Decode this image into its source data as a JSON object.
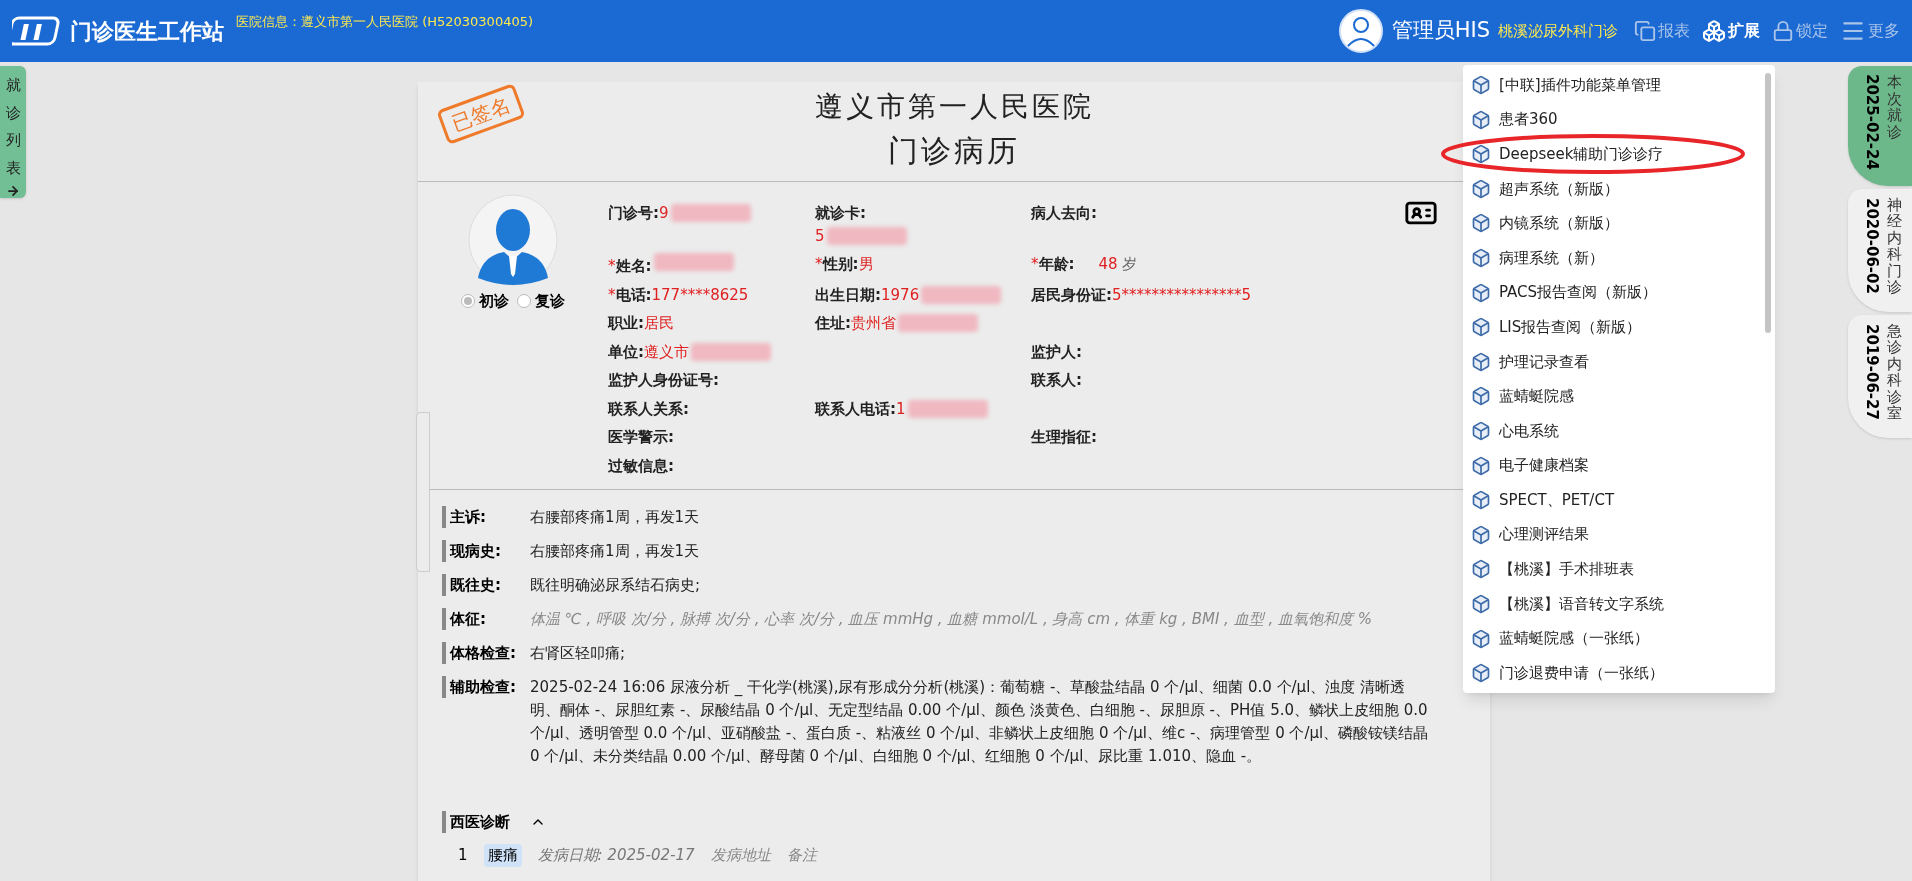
{
  "header": {
    "title": "门诊医生工作站",
    "hospital_info": "医院信息：遵义市第一人民医院 (H52030300405)",
    "user": "管理员HIS",
    "department": "桃溪泌尿外科门诊",
    "toolbar": [
      {
        "kind": "report",
        "label": "报表",
        "selected": false
      },
      {
        "kind": "extend",
        "label": "扩展",
        "selected": true
      },
      {
        "kind": "lock",
        "label": "锁定",
        "selected": false
      },
      {
        "kind": "more",
        "label": "更多",
        "selected": false
      }
    ]
  },
  "left_tab": {
    "chars": [
      "就",
      "诊",
      "列",
      "表"
    ]
  },
  "record": {
    "stamp": "已签名",
    "hospital": "遵义市第一人民医院",
    "title": "门诊病历",
    "visit_types": [
      {
        "label": "初诊",
        "selected": true
      },
      {
        "label": "复诊",
        "selected": false
      }
    ],
    "field_rows": [
      [
        {
          "label": "门诊号:",
          "value": "9",
          "redacted": true
        },
        {
          "label": "就诊卡:",
          "value": "5",
          "redacted": true,
          "wrap": true
        },
        {
          "label": "病人去向:"
        }
      ],
      [
        {
          "marker": "*",
          "label": "姓名:",
          "redacted": true
        },
        {
          "marker": "*",
          "label": "性别:",
          "value": "男"
        },
        {
          "marker": "*",
          "label": "年龄:",
          "value": "48",
          "unit": "岁"
        }
      ],
      [
        {
          "marker": "*",
          "label": "电话:",
          "value": "177****8625"
        },
        {
          "label": "出生日期:",
          "value": "1976",
          "redacted": true
        },
        {
          "label": "居民身份证:",
          "value": "5****************5"
        }
      ],
      [
        {
          "label": "职业:",
          "value": "居民"
        },
        {
          "label": "住址:",
          "value": "贵州省",
          "redacted": true
        },
        null
      ],
      [
        {
          "label": "单位:",
          "value": "遵义市",
          "redacted": true
        },
        null,
        {
          "label": "监护人:"
        }
      ],
      [
        {
          "label": "监护人身份证号:"
        },
        null,
        {
          "label": "联系人:"
        }
      ],
      [
        {
          "label": "联系人关系:"
        },
        {
          "label": "联系人电话:",
          "value": "1",
          "redacted": true
        },
        null
      ],
      [
        {
          "label": "医学警示:"
        },
        null,
        {
          "label": "生理指征:"
        }
      ],
      [
        {
          "label": "过敏信息:"
        },
        null,
        null
      ]
    ],
    "sections": [
      {
        "label": "主诉:",
        "text": "右腰部疼痛1周，再发1天",
        "kind": "normal"
      },
      {
        "label": "现病史:",
        "text": "右腰部疼痛1周，再发1天",
        "kind": "normal"
      },
      {
        "label": "既往史:",
        "text": "既往明确泌尿系结石病史;",
        "kind": "normal"
      },
      {
        "label": "体征:",
        "text": "体温 ℃ , 呼吸 次/分 , 脉搏 次/分 , 心率 次/分 , 血压 mmHg , 血糖 mmol/L , 身高 cm , 体重 kg , BMI , 血型 , 血氧饱和度 %",
        "kind": "hint"
      },
      {
        "label": "体格检查:",
        "text": "右肾区轻叩痛;",
        "kind": "normal"
      },
      {
        "label": "辅助检查:",
        "text": "2025-02-24 16:06 尿液分析 _ 干化学(桃溪),尿有形成分分析(桃溪)：葡萄糖 -、草酸盐结晶 0 个/μl、细菌 0.0 个/μl、浊度 清晰透明、酮体 -、尿胆红素 -、尿酸结晶 0 个/μl、无定型结晶 0.00 个/μl、颜色 淡黄色、白细胞 -、尿胆原 -、PH值 5.0、鳞状上皮细胞 0.0 个/μl、透明管型 0.0 个/μl、亚硝酸盐 -、蛋白质 -、粘液丝 0 个/μl、非鳞状上皮细胞 0 个/μl、维c -、病理管型 0 个/μl、磷酸铵镁结晶 0 个/μl、未分类结晶 0.00 个/μl、酵母菌 0 个/μl、白细胞 0 个/μl、红细胞 0 个/μl、尿比重 1.010、隐血 -。",
        "kind": "normal"
      }
    ],
    "diagnosis": {
      "title": "西医诊断",
      "expanded": true,
      "rows": [
        {
          "index": "1",
          "name": "腰痛",
          "onset": "发病日期: 2025-02-17",
          "fields": [
            "发病地址",
            "备注"
          ]
        }
      ]
    }
  },
  "menu": {
    "items": [
      "[中联]插件功能菜单管理",
      "患者360",
      "Deepseek辅助门诊诊疗",
      "超声系统（新版）",
      "内镜系统（新版）",
      "病理系统（新）",
      "PACS报告查阅（新版）",
      "LIS报告查阅（新版）",
      "护理记录查看",
      "蓝蜻蜓院感",
      "心电系统",
      "电子健康档案",
      "SPECT、PET/CT",
      "心理测评结果",
      "【桃溪】手术排班表",
      "【桃溪】语音转文字系统",
      "蓝蜻蜓院感（一张纸）",
      "门诊退费申请（一张纸）"
    ]
  },
  "visit_tabs": [
    {
      "date": "2025-02-24",
      "dept": "本次就诊",
      "selected": true
    },
    {
      "date": "2020-06-02",
      "dept": "神经内科门诊",
      "selected": false
    },
    {
      "date": "2019-06-27",
      "dept": "急诊内科诊室",
      "selected": false
    }
  ]
}
